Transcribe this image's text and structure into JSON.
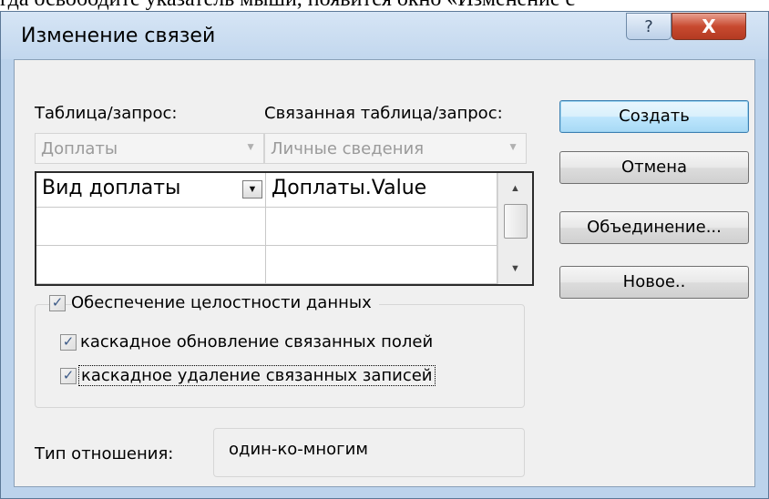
{
  "page_text": "гда освободите указатель мыши, появится окно «Изменение с",
  "window": {
    "title": "Изменение связей",
    "help_label": "?",
    "close_label": "X"
  },
  "left": {
    "table_label": "Таблица/запрос:",
    "related_label": "Связанная таблица/запрос:",
    "table_value": "Доплаты",
    "related_value": "Личные сведения"
  },
  "grid": {
    "rows": [
      {
        "left": "Вид доплаты",
        "right": "Доплаты.Value"
      },
      {
        "left": "",
        "right": ""
      },
      {
        "left": "",
        "right": ""
      }
    ]
  },
  "options": {
    "integrity_label": "Обеспечение целостности данных",
    "integrity_checked": true,
    "cascade_update_label": "каскадное обновление связанных полей",
    "cascade_update_checked": true,
    "cascade_delete_label": "каскадное удаление связанных записей",
    "cascade_delete_checked": true,
    "check_mark": "✓"
  },
  "relation": {
    "label": "Тип отношения:",
    "value": "один-ко-многим"
  },
  "buttons": {
    "create": "Создать",
    "cancel": "Отмена",
    "join": "Объединение...",
    "new": "Новое.."
  },
  "icons": {
    "dropdown": "▼",
    "scroll_up": "▲",
    "scroll_down": "▼"
  },
  "colors": {
    "accent_button": "#bee6fd",
    "check_mark": "#3c5a87",
    "close_button": "#c84a30"
  }
}
